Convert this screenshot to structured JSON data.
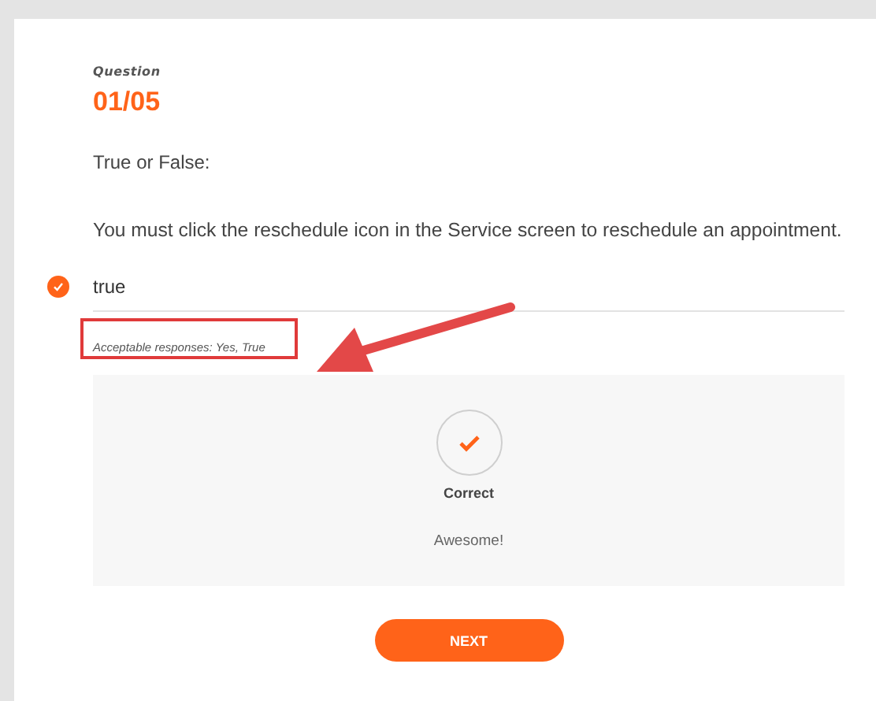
{
  "header": {
    "label": "Question",
    "counter": "01/05"
  },
  "prompt": "True or False:",
  "statement": "You must click the reschedule icon in the Service screen to reschedule an appointment.",
  "answer": {
    "value": "true",
    "correct": true
  },
  "hint": {
    "text": "Acceptable responses: Yes, True",
    "highlighted": true
  },
  "feedback": {
    "result": "Correct",
    "message": "Awesome!",
    "correct": true
  },
  "buttons": [
    "NEXT"
  ]
}
